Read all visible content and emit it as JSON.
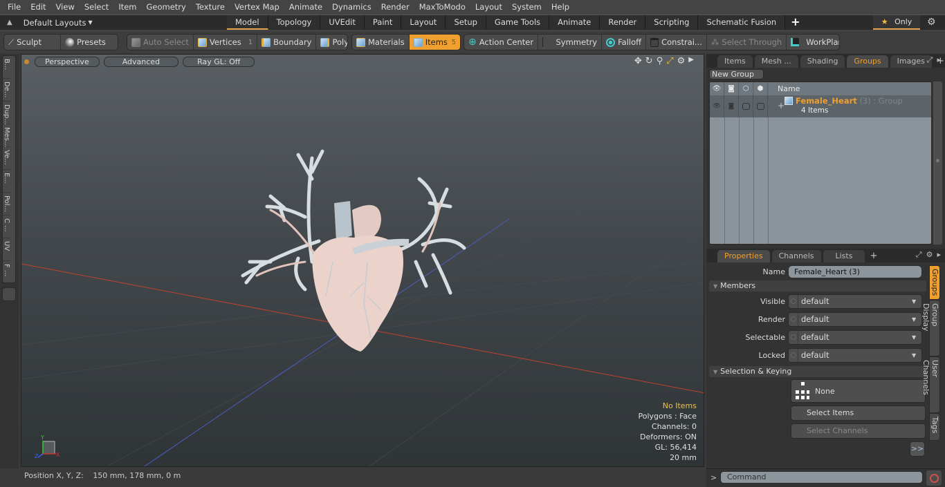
{
  "menubar": {
    "items": [
      "File",
      "Edit",
      "View",
      "Select",
      "Item",
      "Geometry",
      "Texture",
      "Vertex Map",
      "Animate",
      "Dynamics",
      "Render",
      "MaxToModo",
      "Layout",
      "System",
      "Help"
    ]
  },
  "layoutbar": {
    "layout_label": "Default Layouts",
    "tabs": [
      "Model",
      "Topology",
      "UVEdit",
      "Paint",
      "Layout",
      "Setup",
      "Game Tools",
      "Animate",
      "Render",
      "Scripting",
      "Schematic Fusion"
    ],
    "active_tab": "Model",
    "add_label": "+",
    "only_label": "Only"
  },
  "toolbar": {
    "sculpt": "Sculpt",
    "presets": "Presets",
    "auto_select": "Auto Select",
    "vertices": "Vertices",
    "vertices_count": "1",
    "boundary": "Boundary",
    "polygons": "Polygons",
    "materials": "Materials",
    "items": "Items",
    "items_count": "5",
    "action_center": "Action Center",
    "symmetry": "Symmetry",
    "falloff": "Falloff",
    "constraints": "Constrai...",
    "select_through": "Select Through",
    "workplane": "WorkPlane"
  },
  "leftstrip": {
    "items": [
      "B...",
      "De...",
      "Dup...",
      "Mes...",
      "Ve...",
      "E...",
      "Pol...",
      "C ...",
      "UV",
      "F ..."
    ]
  },
  "viewport": {
    "view_mode": "Perspective",
    "shading": "Advanced",
    "raygl": "Ray GL: Off",
    "info": {
      "selection": "No Items",
      "polygons": "Polygons : Face",
      "channels": "Channels: 0",
      "deformers": "Deformers: ON",
      "gl": "GL: 56,414",
      "scale": "20 mm"
    },
    "axis_labels": {
      "x": "X",
      "y": "Y",
      "z": "Z"
    }
  },
  "statusbar": {
    "label": "Position X, Y, Z:",
    "value": "150 mm, 178 mm, 0 m"
  },
  "groups_panel": {
    "tabs": [
      "Items",
      "Mesh ...",
      "Shading",
      "Groups",
      "Images"
    ],
    "active_tab": "Groups",
    "new_group": "New Group",
    "column_name": "Name",
    "groups": [
      {
        "name": "Female_Heart",
        "suffix": "(3)",
        "type": ": Group",
        "count": "4 Items"
      }
    ]
  },
  "properties_panel": {
    "tabs": [
      "Properties",
      "Channels",
      "Lists"
    ],
    "active_tab": "Properties",
    "name_label": "Name",
    "name_value": "Female_Heart (3)",
    "members_section": "Members",
    "members": [
      {
        "label": "Visible",
        "value": "default"
      },
      {
        "label": "Render",
        "value": "default"
      },
      {
        "label": "Selectable",
        "value": "default"
      },
      {
        "label": "Locked",
        "value": "default"
      }
    ],
    "keying_section": "Selection & Keying",
    "keying_value": "None",
    "select_items": "Select Items",
    "select_channels": "Select Channels",
    "more": ">>",
    "side_tabs": [
      "Groups",
      "Group Display",
      "User Channels",
      "Tags"
    ],
    "active_side_tab": "Groups"
  },
  "command": {
    "prompt": ">",
    "placeholder": "Command"
  },
  "colors": {
    "accent": "#f0a030",
    "group_name": "#f0a030",
    "info_highlight": "#f0c040"
  }
}
